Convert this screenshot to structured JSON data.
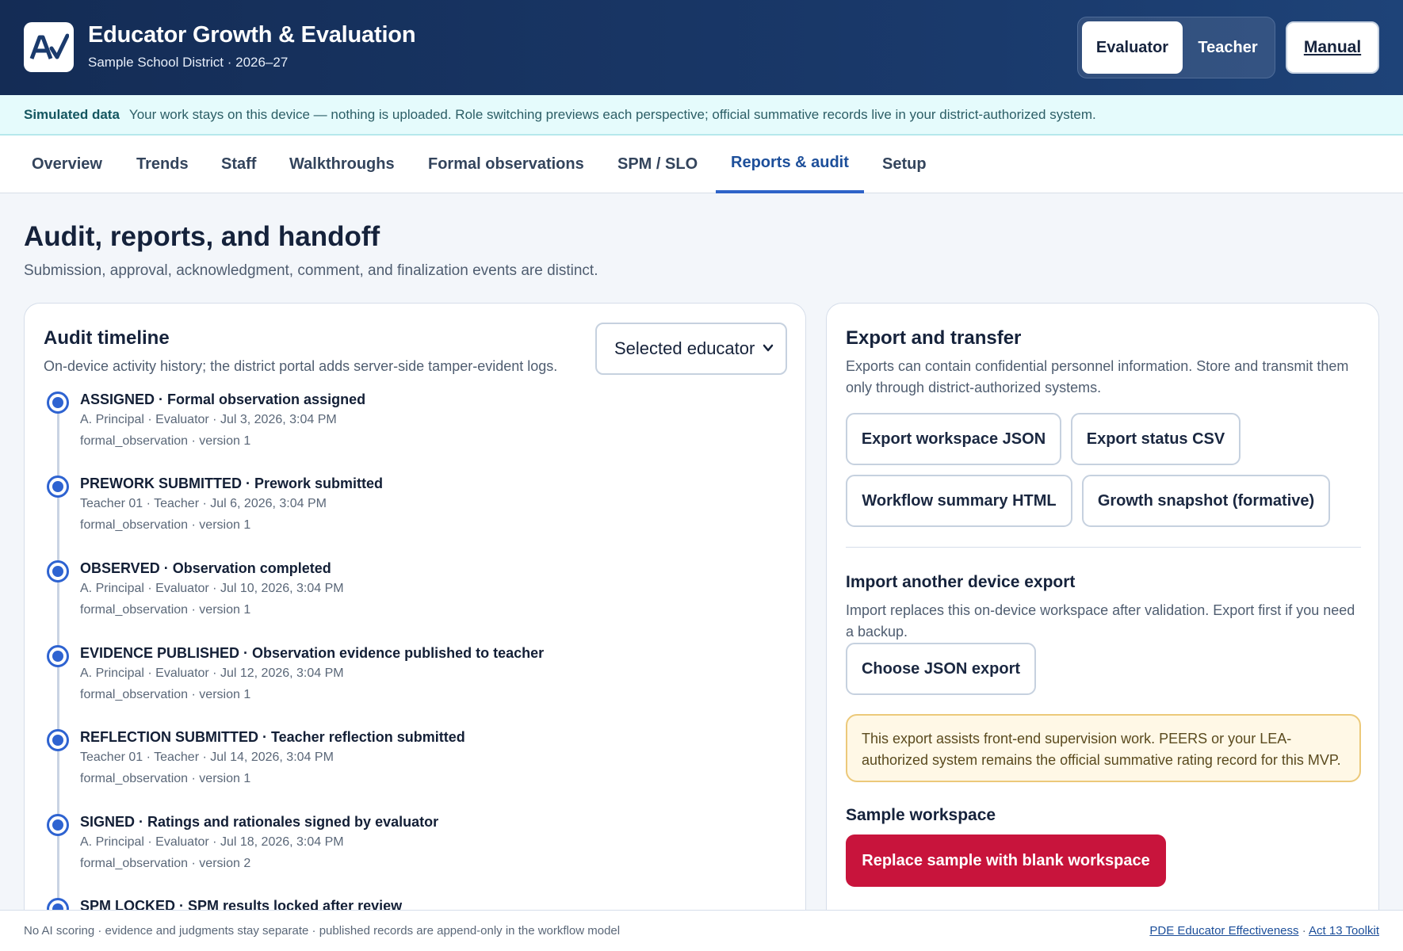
{
  "header": {
    "logo_icon": "checkmark-logo-icon",
    "title": "Educator Growth & Evaluation",
    "subtitle": "Sample School District · 2026–27",
    "roles": {
      "evaluator": "Evaluator",
      "teacher": "Teacher",
      "selected": "Evaluator"
    },
    "manual_label": "Manual"
  },
  "banner": {
    "label": "Simulated data",
    "text": "Your work stays on this device — nothing is uploaded. Role switching previews each perspective; official summative records live in your district-authorized system."
  },
  "tabs": [
    {
      "label": "Overview"
    },
    {
      "label": "Trends"
    },
    {
      "label": "Staff"
    },
    {
      "label": "Walkthroughs"
    },
    {
      "label": "Formal observations"
    },
    {
      "label": "SPM / SLO"
    },
    {
      "label": "Reports & audit",
      "active": true
    },
    {
      "label": "Setup"
    }
  ],
  "page": {
    "title": "Audit, reports, and handoff",
    "subtitle": "Submission, approval, acknowledgment, comment, and finalization events are distinct."
  },
  "audit": {
    "title": "Audit timeline",
    "description": "On-device activity history; the district portal adds server-side tamper-evident logs.",
    "filter_value": "Selected educator",
    "events": [
      {
        "title": "ASSIGNED · Formal observation assigned",
        "meta": "A. Principal · Evaluator · Jul 3, 2026, 3:04 PM",
        "version": "formal_observation · version 1"
      },
      {
        "title": "PREWORK SUBMITTED · Prework submitted",
        "meta": "Teacher 01 · Teacher · Jul 6, 2026, 3:04 PM",
        "version": "formal_observation · version 1"
      },
      {
        "title": "OBSERVED · Observation completed",
        "meta": "A. Principal · Evaluator · Jul 10, 2026, 3:04 PM",
        "version": "formal_observation · version 1"
      },
      {
        "title": "EVIDENCE PUBLISHED · Observation evidence published to teacher",
        "meta": "A. Principal · Evaluator · Jul 12, 2026, 3:04 PM",
        "version": "formal_observation · version 1"
      },
      {
        "title": "REFLECTION SUBMITTED · Teacher reflection submitted",
        "meta": "Teacher 01 · Teacher · Jul 14, 2026, 3:04 PM",
        "version": "formal_observation · version 1"
      },
      {
        "title": "SIGNED · Ratings and rationales signed by evaluator",
        "meta": "A. Principal · Evaluator · Jul 18, 2026, 3:04 PM",
        "version": "formal_observation · version 2"
      },
      {
        "title": "SPM LOCKED · SPM results locked after review",
        "meta": "",
        "version": ""
      }
    ]
  },
  "export": {
    "title": "Export and transfer",
    "description": "Exports can contain confidential personnel information. Store and transmit them only through district-authorized systems.",
    "buttons": {
      "json": "Export workspace JSON",
      "csv": "Export status CSV",
      "html": "Workflow summary HTML",
      "snapshot": "Growth snapshot (formative)"
    },
    "import_title": "Import another device export",
    "import_description": "Import replaces this on-device workspace after validation. Export first if you need a backup.",
    "import_button": "Choose JSON export",
    "notice": "This export assists front-end supervision work. PEERS or your LEA-authorized system remains the official summative rating record for this MVP.",
    "sample_title": "Sample workspace",
    "replace_button": "Replace sample with blank workspace"
  },
  "footer": {
    "text": "No AI scoring · evidence and judgments stay separate · published records are append-only in the workflow model",
    "link1": "PDE Educator Effectiveness",
    "separator": "·",
    "link2": "Act 13 Toolkit"
  },
  "colors": {
    "header_bg": "#142c55",
    "accent": "#2e63c8",
    "danger": "#c8143c",
    "notice_bg": "#fff8e6",
    "banner_bg": "#e5fbfc"
  }
}
